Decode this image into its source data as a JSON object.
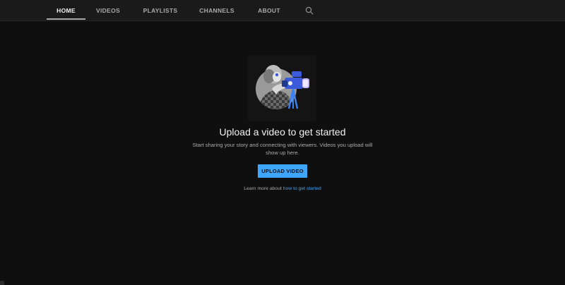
{
  "nav": {
    "tabs": [
      {
        "label": "HOME",
        "active": true
      },
      {
        "label": "VIDEOS",
        "active": false
      },
      {
        "label": "PLAYLISTS",
        "active": false
      },
      {
        "label": "CHANNELS",
        "active": false
      },
      {
        "label": "ABOUT",
        "active": false
      }
    ],
    "search_icon": "search-icon"
  },
  "empty_state": {
    "illustration": "person-with-video-camera-illustration",
    "heading": "Upload a video to get started",
    "description": "Start sharing your story and connecting with viewers. Videos you upload will show up here.",
    "upload_button_label": "UPLOAD VIDEO",
    "learn_prefix": "Learn more about ",
    "learn_link": "how to get started"
  },
  "colors": {
    "background": "#0f0f0f",
    "topbar": "#1a1a1a",
    "accent": "#3ea6ff",
    "text_primary": "#f1f1f1",
    "text_secondary": "#aaaaaa"
  }
}
